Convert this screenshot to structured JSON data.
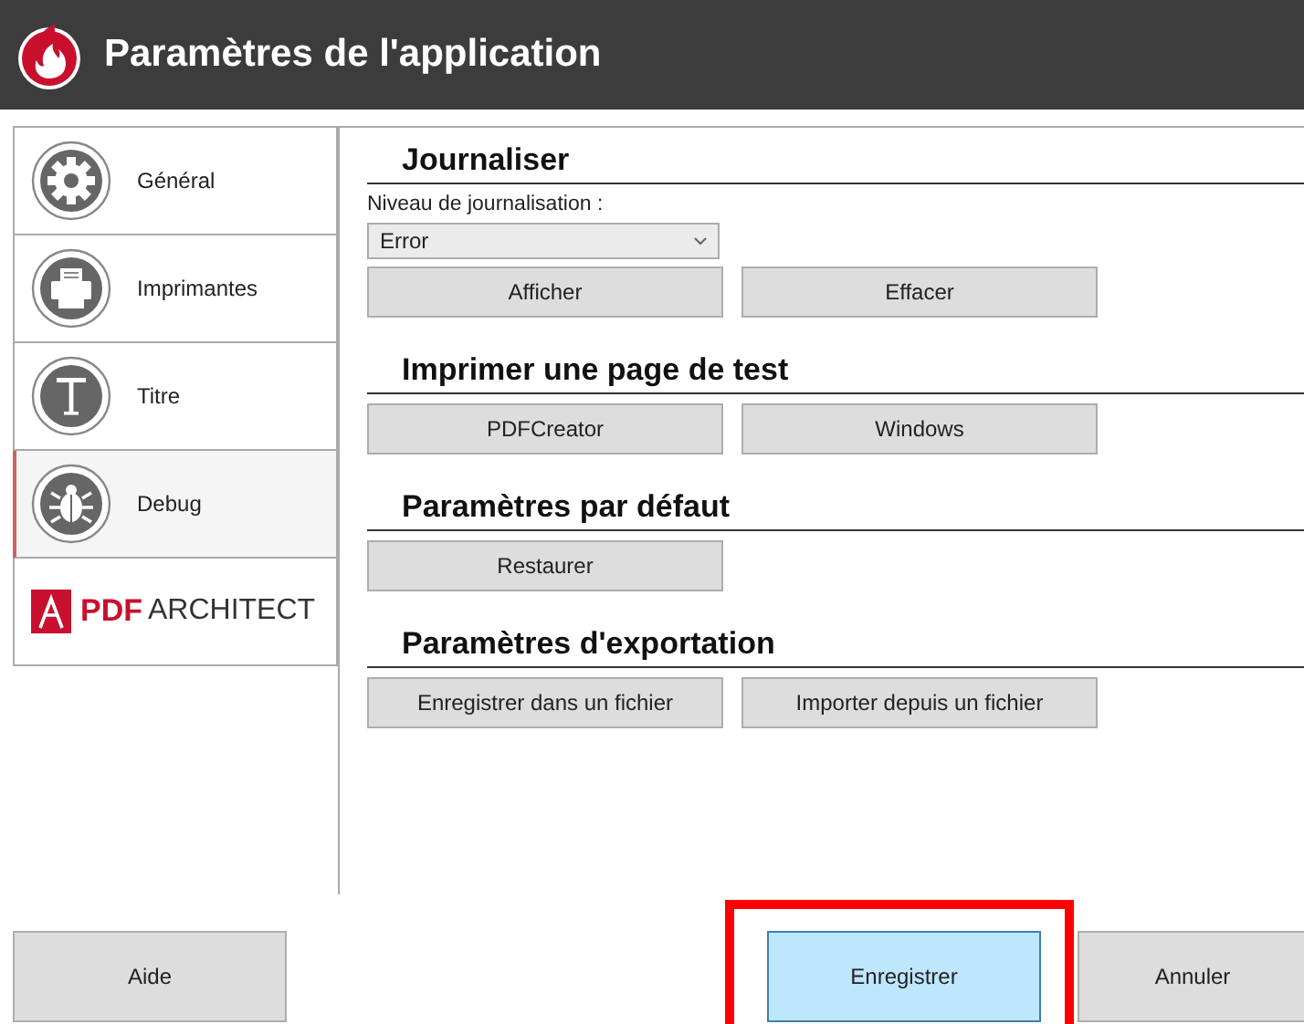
{
  "window": {
    "title": "Paramètres de l'application"
  },
  "sidebar": {
    "items": [
      {
        "label": "Général",
        "kind": "gear",
        "selected": false
      },
      {
        "label": "Imprimantes",
        "kind": "printer",
        "selected": false
      },
      {
        "label": "Titre",
        "kind": "title",
        "selected": false
      },
      {
        "label": "Debug",
        "kind": "bug",
        "selected": true
      }
    ],
    "logo": {
      "brand": "PDF",
      "product": "ARCHITECT"
    }
  },
  "sections": [
    {
      "title": "Journaliser",
      "field_label": "Niveau de journalisation :",
      "dropdown": {
        "value": "Error"
      },
      "buttons": [
        "Afficher",
        "Effacer"
      ]
    },
    {
      "title": "Imprimer une page de test",
      "buttons": [
        "PDFCreator",
        "Windows"
      ]
    },
    {
      "title": "Paramètres par défaut",
      "buttons": [
        "Restaurer"
      ]
    },
    {
      "title": "Paramètres d'exportation",
      "buttons": [
        "Enregistrer dans un fichier",
        "Importer depuis un fichier"
      ]
    }
  ],
  "footer": {
    "buttons": [
      {
        "label": "Aide",
        "kind": "help",
        "primary": false,
        "highlighted": false
      },
      {
        "label": "Enregistrer",
        "kind": "save",
        "primary": true,
        "highlighted": true
      },
      {
        "label": "Annuler",
        "kind": "cancel",
        "primary": false,
        "highlighted": false
      }
    ]
  }
}
